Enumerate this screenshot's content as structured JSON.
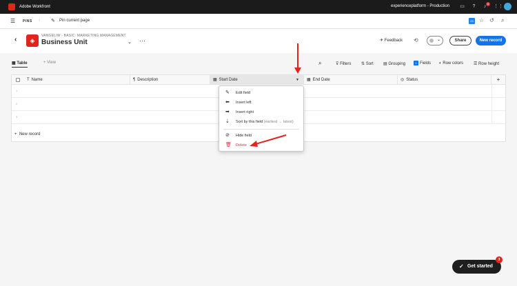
{
  "appbar": {
    "title": "Adobe Workfront",
    "org": "experienceplatform - Production",
    "notif_count": "8"
  },
  "nav": {
    "pins": "PINS",
    "pin_current": "Pin current page",
    "cal_num": "23"
  },
  "header": {
    "breadcrumb": "VANGELIW - BASIC: MARKETING MANAGEMENT",
    "title": "Business Unit",
    "feedback": "Feedback",
    "share": "Share",
    "new_record": "New record"
  },
  "toolbar": {
    "table": "Table",
    "view": "View",
    "filters": "Filters",
    "sort": "Sort",
    "grouping": "Grouping",
    "fields_count": "1",
    "fields": "Fields",
    "row_colors": "Row colors",
    "row_height": "Row height"
  },
  "columns": [
    {
      "label": "Name",
      "icon": "text-icon"
    },
    {
      "label": "Description",
      "icon": "paragraph-icon"
    },
    {
      "label": "Start Date",
      "icon": "calendar-icon"
    },
    {
      "label": "End Date",
      "icon": "calendar-icon"
    },
    {
      "label": "Status",
      "icon": "status-icon"
    }
  ],
  "rows": [
    "1",
    "2",
    "3"
  ],
  "grid": {
    "new_record": "New record"
  },
  "menu": {
    "edit": "Edit field",
    "insert_left": "Insert left",
    "insert_right": "Insert right",
    "sort": "Sort by this field",
    "sort_sub": "(earliest → latest)",
    "hide": "Hide field",
    "delete": "Delete"
  },
  "getstarted": {
    "label": "Get started",
    "badge": "3"
  },
  "colors": {
    "accent": "#1473e6",
    "brand": "#e1251b",
    "annotation": "#e1251b",
    "delete": "#d7373f"
  }
}
